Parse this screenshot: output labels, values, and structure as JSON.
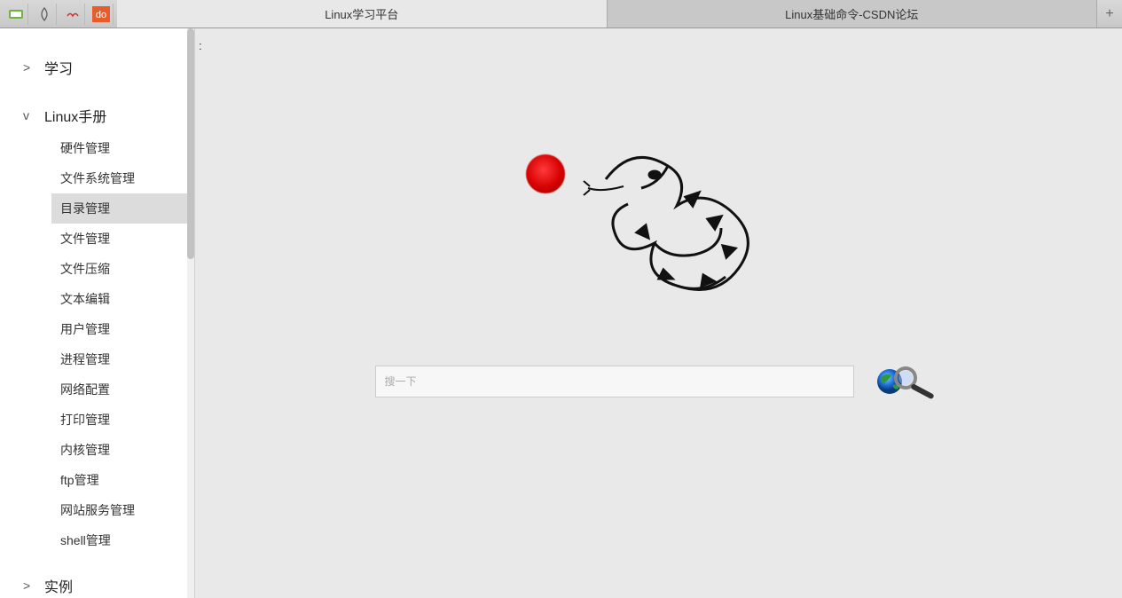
{
  "tabs": {
    "active": "Linux学习平台",
    "inactive": "Linux基础命令-CSDN论坛"
  },
  "sidebar": {
    "study": {
      "label": "学习",
      "chevron": ">"
    },
    "manual": {
      "label": "Linux手册",
      "chevron": "v",
      "items": [
        "硬件管理",
        "文件系统管理",
        "目录管理",
        "文件管理",
        "文件压缩",
        "文本编辑",
        "用户管理",
        "进程管理",
        "网络配置",
        "打印管理",
        "内核管理",
        "ftp管理",
        "网站服务管理",
        "shell管理"
      ],
      "selected_index": 2
    },
    "examples": {
      "label": "实例",
      "chevron": ">"
    }
  },
  "content": {
    "colon_text": ":",
    "search_placeholder": "搜一下"
  },
  "icons": {
    "toolbar": [
      "app-icon-1",
      "app-icon-2",
      "app-icon-3",
      "app-icon-do"
    ]
  }
}
